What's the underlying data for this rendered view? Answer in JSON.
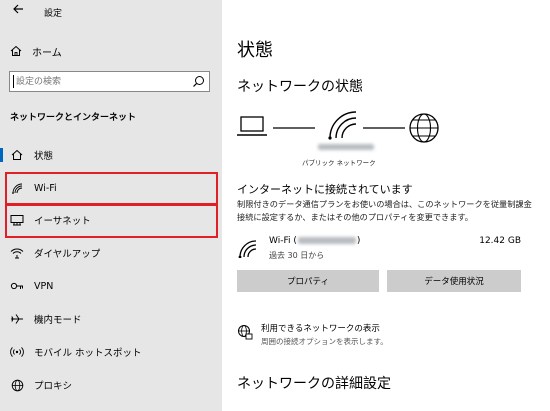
{
  "topbar": {
    "back_icon": "back-arrow-icon",
    "title": "設定"
  },
  "sidebar": {
    "home_label": "ホーム",
    "search_placeholder": "設定の検索",
    "section_title": "ネットワークとインターネット",
    "items": [
      {
        "label": "状態",
        "icon": "home-icon",
        "selected": true
      },
      {
        "label": "Wi-Fi",
        "icon": "wifi-icon"
      },
      {
        "label": "イーサネット",
        "icon": "ethernet-icon"
      },
      {
        "label": "ダイヤルアップ",
        "icon": "dialup-icon"
      },
      {
        "label": "VPN",
        "icon": "vpn-icon"
      },
      {
        "label": "機内モード",
        "icon": "airplane-icon"
      },
      {
        "label": "モバイル ホットスポット",
        "icon": "hotspot-icon"
      },
      {
        "label": "プロキシ",
        "icon": "globe-icon"
      }
    ]
  },
  "main": {
    "page_title": "状態",
    "network_status_heading": "ネットワークの状態",
    "network_name": "パブリック ネットワーク",
    "connected_title": "インターネットに接続されています",
    "connected_desc": "制限付きのデータ通信プランをお使いの場合は、このネットワークを従量制課金接続に設定するか、またはその他のプロパティを変更できます。",
    "connection": {
      "name": "Wi-Fi (",
      "name_close": ")",
      "since": "過去 30 日から",
      "usage": "12.42 GB"
    },
    "properties_button": "プロパティ",
    "data_usage_button": "データ使用状況",
    "available_networks_title": "利用できるネットワークの表示",
    "available_networks_sub": "周囲の接続オプションを表示します。",
    "advanced_heading": "ネットワークの詳細設定"
  },
  "colors": {
    "highlight": "#e01f26",
    "accent": "#0067c0",
    "sidebar_bg": "#e6e6e6",
    "button_bg": "#cccccc"
  }
}
